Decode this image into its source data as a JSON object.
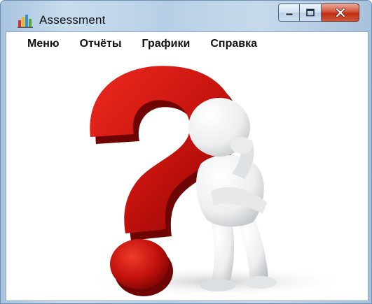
{
  "window": {
    "title": "Assessment",
    "icon": "app-icon",
    "buttons": {
      "minimize": "minimize-icon",
      "maximize": "maximize-icon",
      "close": "close-icon"
    }
  },
  "menu": {
    "items": [
      {
        "label": "Меню"
      },
      {
        "label": "Отчёты"
      },
      {
        "label": "Графики"
      },
      {
        "label": "Справка"
      }
    ]
  },
  "illustration": {
    "subject": "question-mark-thinking-figure",
    "accent_color": "#c4120d"
  }
}
